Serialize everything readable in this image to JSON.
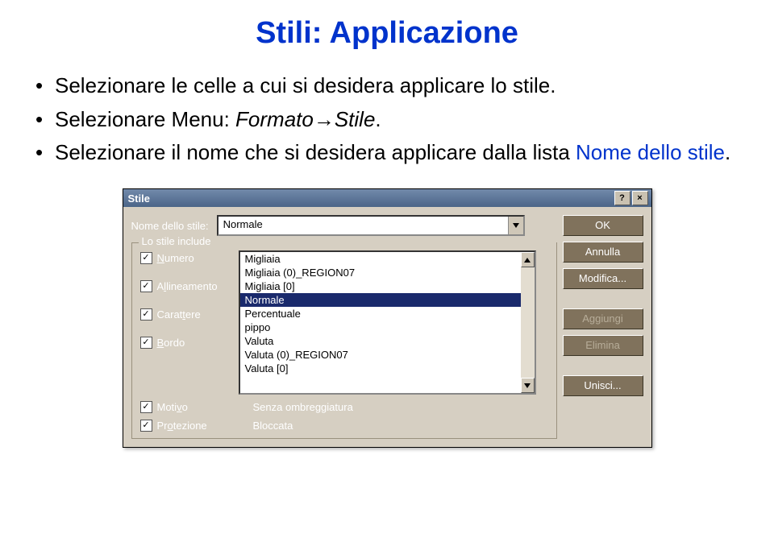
{
  "page": {
    "title": "Stili: Applicazione",
    "bullets": {
      "b1": "Selezionare le celle a cui si desidera applicare lo stile.",
      "b2_prefix": "Selezionare Menu: ",
      "b2_path1": "Formato",
      "b2_arrow": "→",
      "b2_path2": "Stile",
      "b2_suffix": ".",
      "b3_prefix": "Selezionare il nome che si desidera applicare dalla lista ",
      "b3_hl": "Nome dello stile",
      "b3_suffix": "."
    }
  },
  "dialog": {
    "title": "Stile",
    "help_glyph": "?",
    "close_glyph": "×",
    "style_name_label": "Nome dello stile:",
    "combo_value": "Normale",
    "group_label": "Lo stile include",
    "buttons": {
      "ok": "OK",
      "cancel": "Annulla",
      "modify": "Modifica...",
      "add": "Aggiungi",
      "delete": "Elimina",
      "merge": "Unisci..."
    },
    "list_items": [
      "Migliaia",
      "Migliaia (0)_REGION07",
      "Migliaia [0]",
      "Normale",
      "Percentuale",
      "pippo",
      "Valuta",
      "Valuta (0)_REGION07",
      "Valuta [0]"
    ],
    "selected_index": 3,
    "checks": {
      "numero": {
        "pre": "",
        "ul": "N",
        "post": "umero"
      },
      "allineamento": {
        "pre": "A",
        "ul": "l",
        "post": "lineamento"
      },
      "carattere": {
        "pre": "Carat",
        "ul": "t",
        "post": "ere"
      },
      "bordo": {
        "pre": "",
        "ul": "B",
        "post": "ordo"
      },
      "motivo": {
        "pre": "Moti",
        "ul": "v",
        "post": "o"
      },
      "protezione": {
        "pre": "Pr",
        "ul": "o",
        "post": "tezione"
      }
    },
    "values": {
      "motivo": "Senza ombreggiatura",
      "protezione": "Bloccata"
    }
  }
}
